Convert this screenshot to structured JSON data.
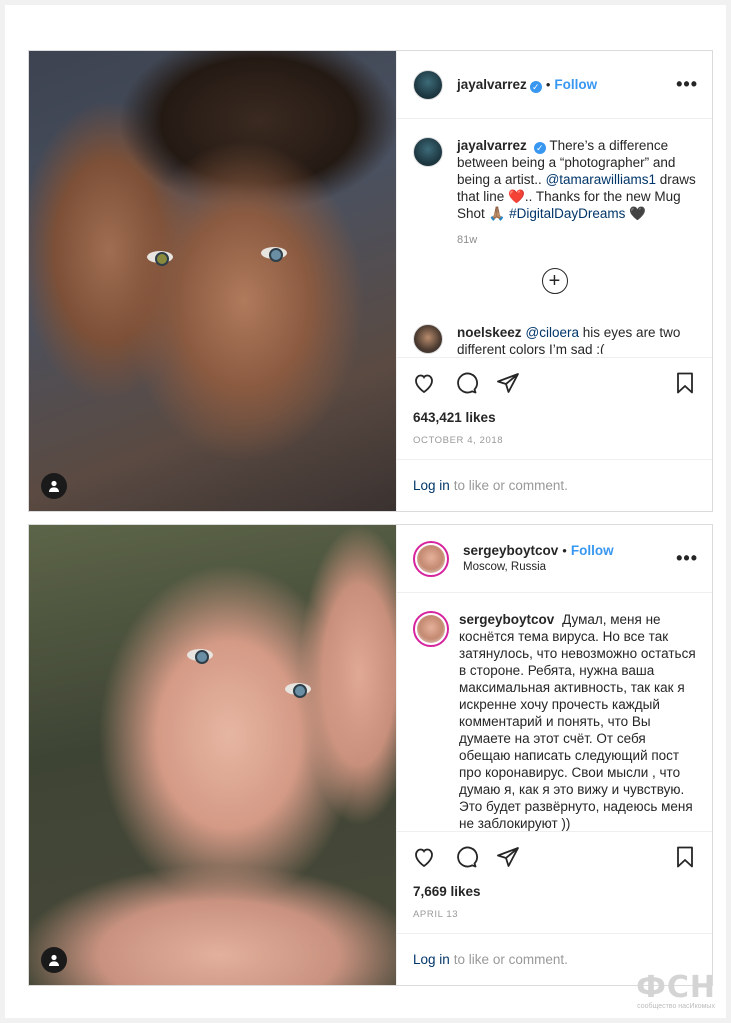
{
  "posts": [
    {
      "username": "jayalvarrez",
      "verified": true,
      "follow_label": "Follow",
      "separator": "•",
      "more_label": "•••",
      "caption": {
        "username": "jayalvarrez",
        "part1": "There’s a difference between being a “photographer” and being a artist.. ",
        "mention": "@tamarawilliams1",
        "part2": " draws that line ❤️.. Thanks for the new Mug Shot 🙏🏽 ",
        "hashtag": "#DigitalDayDreams",
        "part3": " 🖤"
      },
      "age": "81w",
      "load_more_label": "+",
      "comment": {
        "username": "noelskeez",
        "mention": "@ciloera",
        "text": " his eyes are two different colors I’m sad :("
      },
      "likes": "643,421 likes",
      "date": "OCTOBER 4, 2018",
      "login_link": "Log in",
      "login_rest": "to like or comment."
    },
    {
      "username": "sergeyboytcov",
      "verified": false,
      "follow_label": "Follow",
      "separator": "•",
      "location": "Moscow, Russia",
      "more_label": "•••",
      "caption": {
        "username": "sergeyboytcov",
        "text": "Думал, меня не коснётся тема вируса. Но все так затянулось, что невозможно остаться в стороне. Ребята, нужна ваша максимальная активность, так как я искренне хочу прочесть каждый комментарий и понять, что Вы думаете на этот счёт. От себя обещаю написать следующий пост про коронавирус. Свои мысли , что думаю я, как я это вижу и чувствую. Это будет развёрнуто, надеюсь меня не заблокируют ))"
      },
      "likes": "7,669 likes",
      "date": "APRIL 13",
      "login_link": "Log in",
      "login_rest": "to like or comment."
    }
  ],
  "watermark": {
    "logo": "ФСН",
    "tagline": "сообщество насИкомых"
  },
  "colors": {
    "accent": "#3897f0",
    "link": "#003569",
    "muted": "#8e8e8e",
    "border": "#dbdbdb"
  }
}
